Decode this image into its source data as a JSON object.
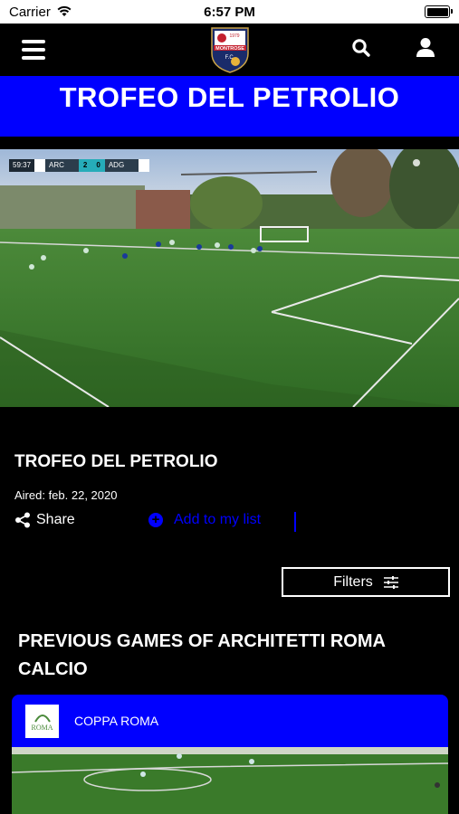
{
  "status_bar": {
    "carrier": "Carrier",
    "time": "6:57 PM",
    "icons": [
      "wifi-icon",
      "battery-icon"
    ]
  },
  "nav": {
    "icons": [
      "hamburger-menu-icon",
      "club-logo",
      "search-icon",
      "user-icon"
    ],
    "logo": {
      "year": "1979",
      "name": "MONTROSE",
      "sub": "F.C."
    }
  },
  "banner": {
    "title": "TROFEO DEL PETROLIO"
  },
  "video": {
    "scorebug": {
      "clock": "59:37",
      "home": "ARC",
      "home_score": "2",
      "away_score": "0",
      "away": "ADG"
    }
  },
  "match": {
    "title": "TROFEO DEL PETROLIO",
    "aired": "Aired: feb. 22, 2020",
    "share_label": "Share",
    "add_to_list_label": "Add to my list"
  },
  "filters": {
    "label": "Filters"
  },
  "section": {
    "title": "PREVIOUS GAMES OF ARCHITETTI ROMA CALCIO"
  },
  "cards": [
    {
      "label": "COPPA ROMA",
      "logo_text": "ROMA"
    }
  ],
  "colors": {
    "accent": "#0000ff",
    "background": "#000000",
    "text": "#ffffff"
  }
}
